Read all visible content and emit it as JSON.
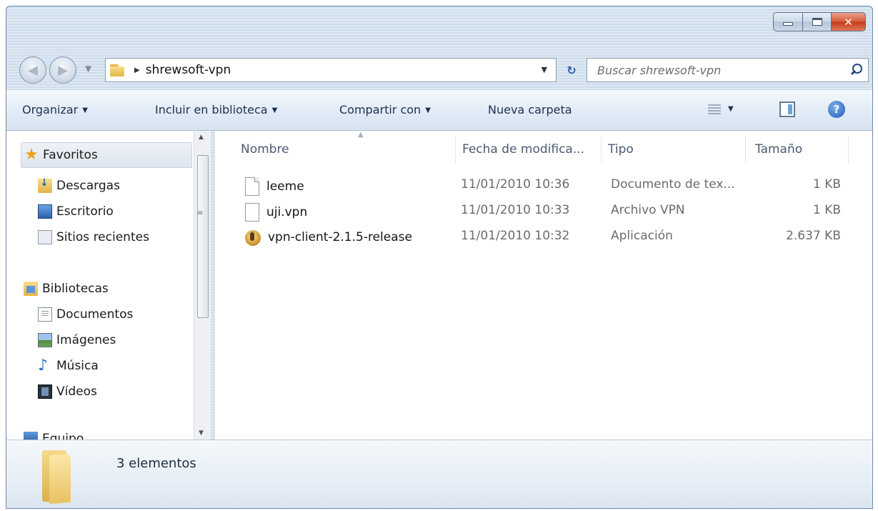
{
  "window": {
    "controls": {
      "minimize_icon": "minimize-icon",
      "maximize_icon": "maximize-icon",
      "close_label": "✕"
    }
  },
  "navigation": {
    "back_icon": "back-arrow-icon",
    "forward_icon": "forward-arrow-icon",
    "breadcrumb": [
      "shrewsoft-vpn"
    ],
    "refresh_icon": "refresh-icon",
    "search_placeholder": "Buscar shrewsoft-vpn"
  },
  "toolbar": {
    "organize": "Organizar",
    "include_library": "Incluir en biblioteca",
    "share_with": "Compartir con",
    "new_folder": "Nueva carpeta",
    "view_icon": "view-options-icon",
    "preview_icon": "preview-pane-icon",
    "help_icon": "help-icon",
    "help_label": "?"
  },
  "sidebar": {
    "favorites": {
      "label": "Favoritos",
      "items": [
        {
          "label": "Descargas",
          "icon": "downloads-folder-icon"
        },
        {
          "label": "Escritorio",
          "icon": "desktop-icon"
        },
        {
          "label": "Sitios recientes",
          "icon": "recent-places-icon"
        }
      ]
    },
    "libraries": {
      "label": "Bibliotecas",
      "items": [
        {
          "label": "Documentos",
          "icon": "documents-icon"
        },
        {
          "label": "Imágenes",
          "icon": "pictures-icon"
        },
        {
          "label": "Música",
          "icon": "music-icon"
        },
        {
          "label": "Vídeos",
          "icon": "videos-icon"
        }
      ]
    },
    "computer": {
      "label": "Equipo",
      "icon": "computer-icon"
    }
  },
  "file_list": {
    "columns": [
      "Nombre",
      "Fecha de modifica...",
      "Tipo",
      "Tamaño"
    ],
    "rows": [
      {
        "name": "leeme",
        "date": "11/01/2010 10:36",
        "type": "Documento de tex...",
        "size": "1 KB",
        "icon": "text-document-icon"
      },
      {
        "name": "uji.vpn",
        "date": "11/01/2010 10:33",
        "type": "Archivo VPN",
        "size": "1 KB",
        "icon": "vpn-file-icon"
      },
      {
        "name": "vpn-client-2.1.5-release",
        "date": "11/01/2010 10:32",
        "type": "Aplicación",
        "size": "2.637 KB",
        "icon": "application-icon"
      }
    ]
  },
  "details_pane": {
    "count": "3 elementos",
    "icon": "folder-icon"
  },
  "colors": {
    "frame": "#cfdeec",
    "toolbar_text": "#1d3150",
    "close_button": "#d65a3a"
  }
}
